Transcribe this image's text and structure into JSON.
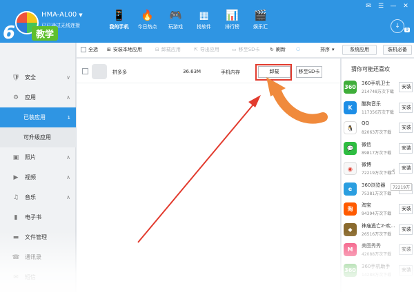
{
  "header": {
    "device_name": "HMA-AL00",
    "caret": "▼",
    "connection_status": "已已通过无线连接",
    "logo_number": "6",
    "logo_tag": "教学",
    "download_badge": "9"
  },
  "nav": [
    {
      "label": "我的手机",
      "icon": "📱"
    },
    {
      "label": "今日热点",
      "icon": "🔥"
    },
    {
      "label": "玩游戏",
      "icon": "🎮"
    },
    {
      "label": "找软件",
      "icon": "▦"
    },
    {
      "label": "排行榜",
      "icon": "📊"
    },
    {
      "label": "娱乐汇",
      "icon": "🎬"
    }
  ],
  "window_controls": [
    "✉",
    "☰",
    "—",
    "✕"
  ],
  "sidebar": {
    "items": [
      {
        "label": "安全",
        "icon": "🛡",
        "chevron": "∨"
      },
      {
        "label": "应用",
        "icon": "⚙",
        "chevron": "∧"
      },
      {
        "label": "已装应用",
        "count": "1"
      },
      {
        "label": "可升级应用"
      },
      {
        "label": "照片",
        "icon": "▣",
        "chevron": "∧"
      },
      {
        "label": "视频",
        "icon": "▶",
        "chevron": "∧"
      },
      {
        "label": "音乐",
        "icon": "♫",
        "chevron": "∧"
      },
      {
        "label": "电子书",
        "icon": "▮"
      },
      {
        "label": "文件管理",
        "icon": "▬"
      },
      {
        "label": "通讯录",
        "icon": "☎"
      },
      {
        "label": "短信",
        "icon": "✉"
      }
    ]
  },
  "toolbar": {
    "select_all": "全选",
    "install_local": "安装本地应用",
    "uninstall": "卸载应用",
    "export": "导出应用",
    "move_sd": "移至SD卡",
    "refresh": "刷新",
    "sort": "排序",
    "system_apps": "系统应用",
    "essentials": "装机必备"
  },
  "apps": [
    {
      "name": "拼多多",
      "size": "36.63M",
      "location": "手机内存",
      "uninstall": "卸载",
      "move": "移至SD卡"
    }
  ],
  "recommend": {
    "title": "猜你可能还喜欢",
    "button": "安装",
    "tooltip": "72219万",
    "items": [
      {
        "name": "360手机卫士",
        "downloads": "214748万次下载",
        "color": "#3fae3a",
        "glyph": "360"
      },
      {
        "name": "酷狗音乐",
        "downloads": "117356万次下载",
        "color": "#1d8ee6",
        "glyph": "K"
      },
      {
        "name": "QQ",
        "downloads": "82063万次下载",
        "color": "#ffffff",
        "glyph": "🐧"
      },
      {
        "name": "微信",
        "downloads": "89817万次下载",
        "color": "#2ebd41",
        "glyph": "💬"
      },
      {
        "name": "微博",
        "downloads": "72219万次下载",
        "color": "#f7f7f7",
        "glyph": "◉"
      },
      {
        "name": "360浏览器",
        "downloads": "75381万次下载",
        "color": "#2a9ee0",
        "glyph": "e"
      },
      {
        "name": "淘宝",
        "downloads": "94394万次下载",
        "color": "#ff5a00",
        "glyph": "淘"
      },
      {
        "name": "神庙逃亡2-欢...",
        "downloads": "26516万次下载",
        "color": "#8a6a2e",
        "glyph": "◆"
      },
      {
        "name": "美图秀秀",
        "downloads": "42088万次下载",
        "color": "#f23e6e",
        "glyph": "M"
      },
      {
        "name": "360手机助手",
        "downloads": "14288万次下载",
        "color": "#3fae3a",
        "glyph": "360"
      }
    ]
  },
  "colors": {
    "accent": "#2f95e3",
    "highlight": "#e23b2e",
    "arrow_orange": "#f08a3c"
  }
}
